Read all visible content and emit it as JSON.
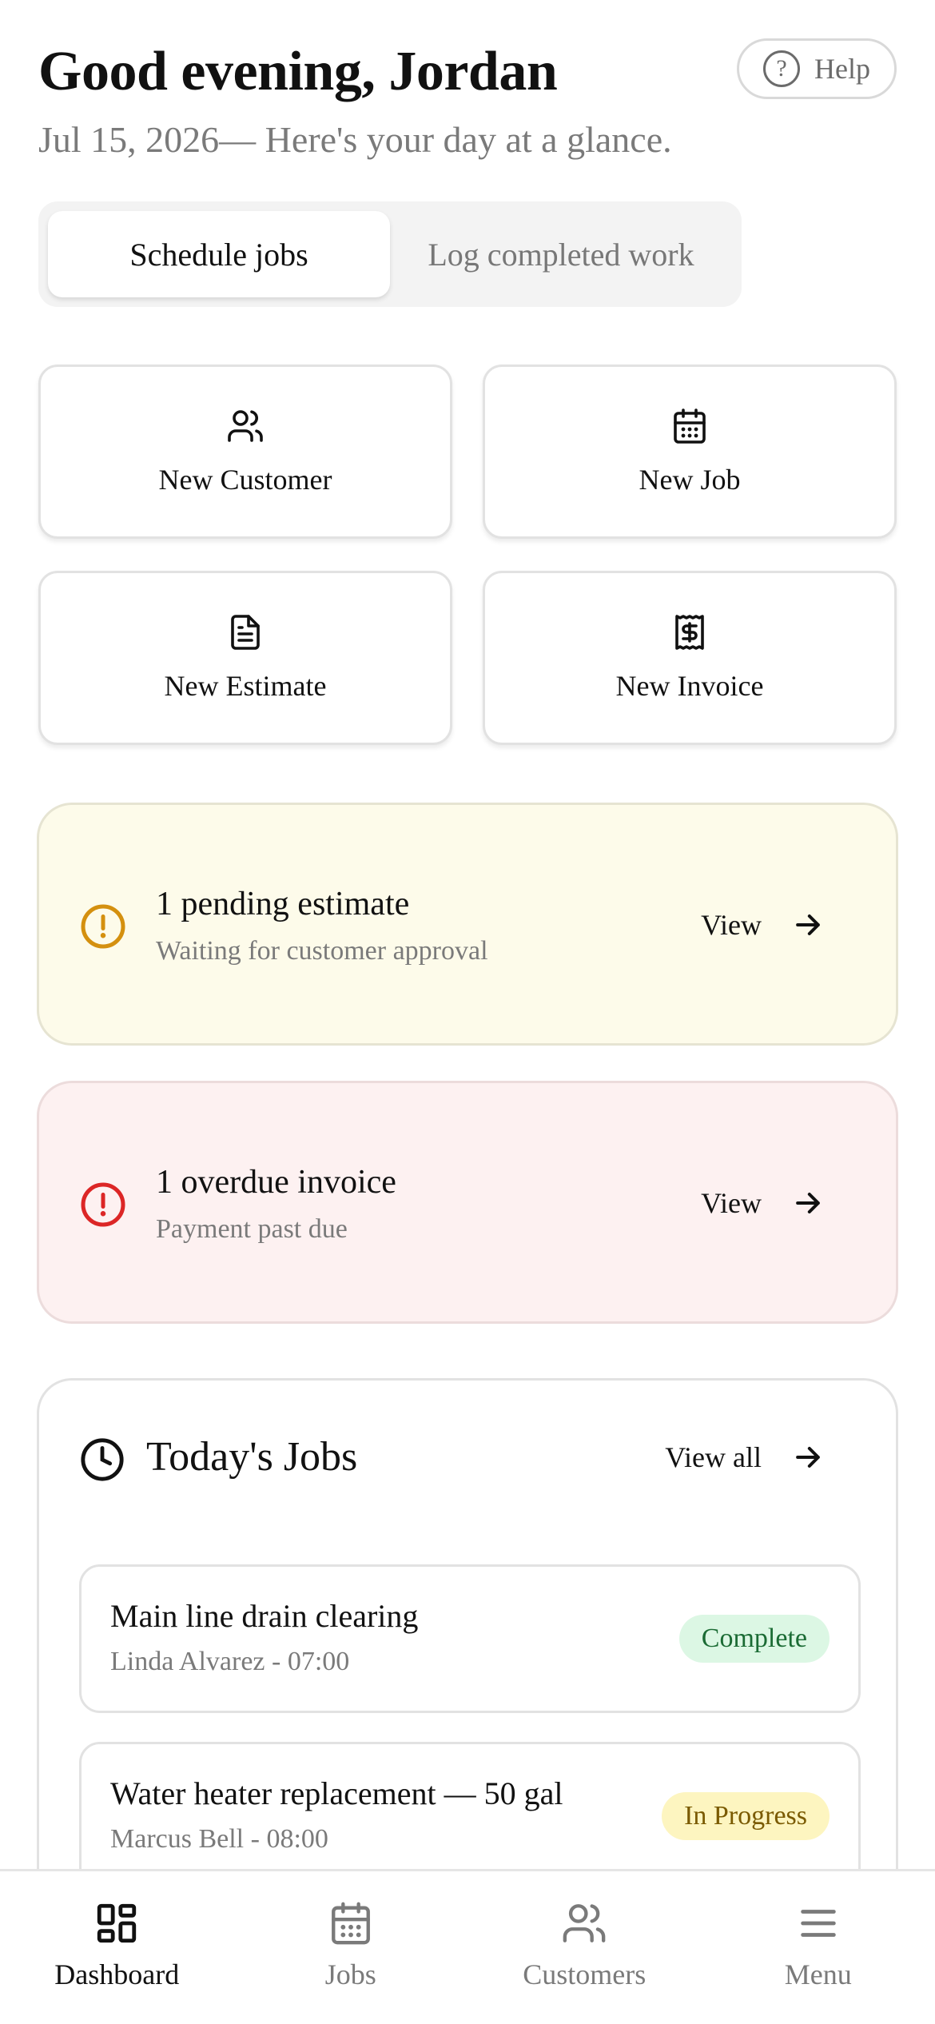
{
  "header": {
    "greeting": "Good evening, Jordan",
    "subtitle": "Jul 15, 2026— Here's your day at a glance.",
    "help_label": "Help",
    "help_icon": "help-circle-icon"
  },
  "segment": {
    "tabs": [
      {
        "label": "Schedule jobs",
        "active": true
      },
      {
        "label": "Log completed work",
        "active": false
      }
    ]
  },
  "quick_actions": [
    {
      "label": "New Customer",
      "icon": "users-icon"
    },
    {
      "label": "New Job",
      "icon": "calendar-icon"
    },
    {
      "label": "New Estimate",
      "icon": "document-icon"
    },
    {
      "label": "New Invoice",
      "icon": "receipt-icon"
    }
  ],
  "alerts": [
    {
      "title": "1 pending estimate",
      "subtitle": "Waiting for customer approval",
      "action": "View",
      "icon": "alert-circle-icon",
      "color": "#d4900f"
    },
    {
      "title": "1 overdue invoice",
      "subtitle": "Payment past due",
      "action": "View",
      "icon": "alert-circle-icon",
      "color": "#dc2626"
    }
  ],
  "todays_jobs": {
    "title": "Today's Jobs",
    "view_all": "View all",
    "icon": "clock-icon",
    "jobs": [
      {
        "title": "Main line drain clearing",
        "meta": "Linda Alvarez - 07:00",
        "status": "Complete"
      },
      {
        "title": "Water heater replacement — 50 gal",
        "meta": "Marcus Bell - 08:00",
        "status": "In Progress"
      }
    ]
  },
  "bottom_nav": [
    {
      "label": "Dashboard",
      "icon": "dashboard-icon",
      "active": true
    },
    {
      "label": "Jobs",
      "icon": "calendar-icon",
      "active": false
    },
    {
      "label": "Customers",
      "icon": "users-icon",
      "active": false
    },
    {
      "label": "Menu",
      "icon": "menu-icon",
      "active": false
    }
  ],
  "colors": {
    "warn_bg": "#fdfbea",
    "danger_bg": "#fdf1f1",
    "complete_bg": "#dcf7e4",
    "progress_bg": "#fdf5c0"
  }
}
